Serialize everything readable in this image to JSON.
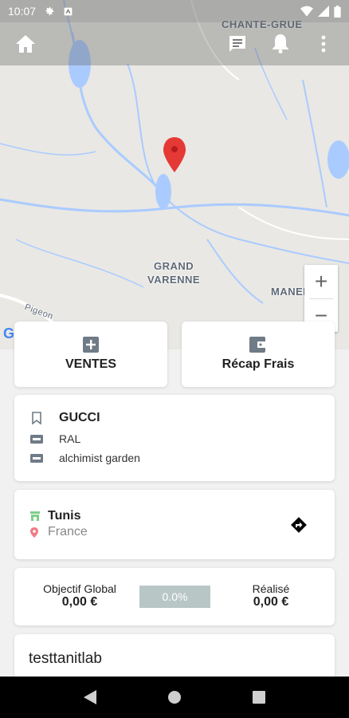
{
  "status_bar": {
    "time": "10:07"
  },
  "map": {
    "labels": {
      "top": "CHANTE-GRUE",
      "center_line1": "GRAND",
      "center_line2": "VARENNE",
      "right": "MANERBE",
      "road": "Pigeon"
    },
    "zoom_in": "+",
    "zoom_out": "−"
  },
  "actions": {
    "sales_label": "VENTES",
    "expenses_label": "Récap Frais"
  },
  "brand": {
    "name": "GUCCI",
    "line1": "RAL",
    "line2": "alchimist garden"
  },
  "location": {
    "city": "Tunis",
    "country": "France"
  },
  "objective": {
    "global_label": "Objectif Global",
    "global_value": "0,00 €",
    "progress_text": "0.0%",
    "progress_fraction": 0,
    "done_label": "Réalisé",
    "done_value": "0,00 €"
  },
  "user": {
    "name": "testtanitlab"
  },
  "colors": {
    "marker": "#e53935",
    "progress_bg": "#b8c6c6",
    "nav": "#000000"
  }
}
